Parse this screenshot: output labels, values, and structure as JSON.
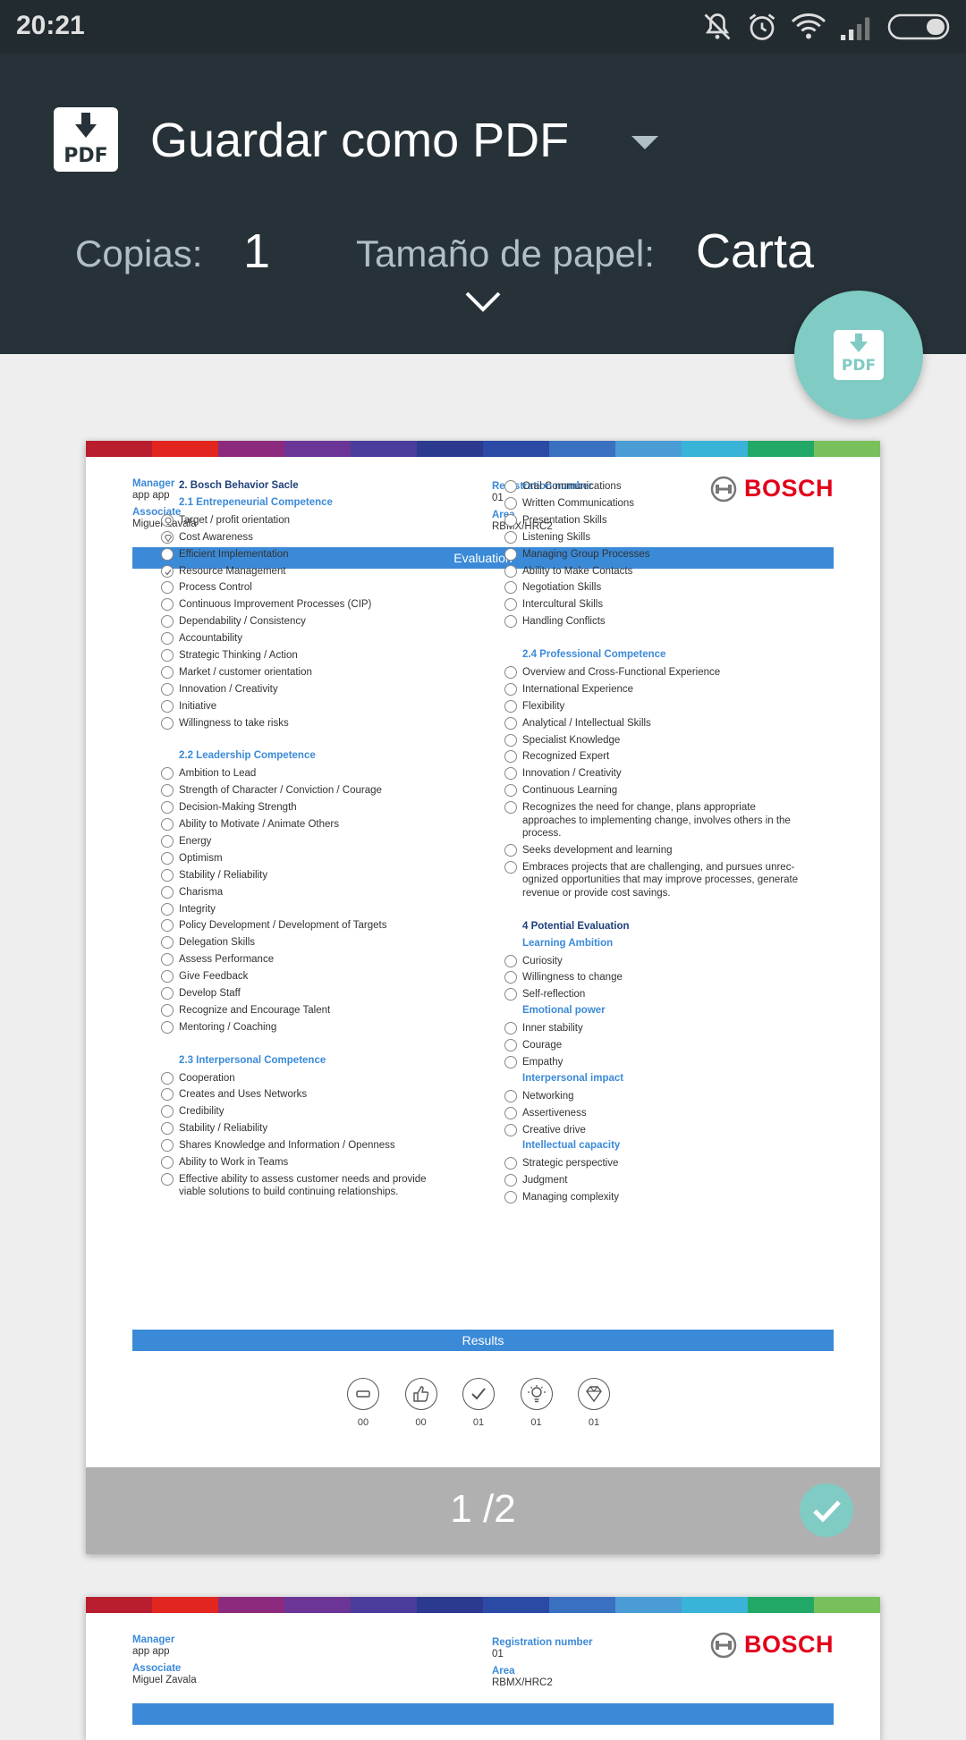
{
  "status_bar": {
    "time": "20:21"
  },
  "header": {
    "destination": "Guardar como PDF",
    "pdf_icon_label": "PDF",
    "copies_label": "Copias:",
    "copies_value": "1",
    "paper_label": "Tamaño de papel:",
    "paper_value": "Carta",
    "fab_label": "PDF"
  },
  "colors": {
    "header_bg": "#263238",
    "fab": "#80cbc4",
    "accent_blue": "#3b8ad8",
    "bosch_red": "#e2001a"
  },
  "document": {
    "manager_label": "Manager",
    "manager_value": "app app",
    "associate_label": "Associate",
    "associate_value": "Miguel Zavala",
    "reg_label": "Registration number",
    "reg_value": "01",
    "area_label": "Area",
    "area_value": "RBMX/HRC2",
    "brand": "BOSCH",
    "evaluation_title": "Evaluation",
    "results_title": "Results",
    "left_column": [
      {
        "type": "heading",
        "text": "2. Bosch Behavior Sacle",
        "dark": true
      },
      {
        "type": "heading",
        "text": "2.1 Entrepeneurial Competence"
      },
      {
        "type": "item",
        "text": "Target / profit orientation",
        "mark": "bulb"
      },
      {
        "type": "item",
        "text": "Cost Awareness",
        "mark": "gem"
      },
      {
        "type": "item",
        "text": "Efficient Implementation"
      },
      {
        "type": "item",
        "text": "Resource Management",
        "mark": "check"
      },
      {
        "type": "item",
        "text": "Process Control"
      },
      {
        "type": "item",
        "text": "Continuous Improvement Processes (CIP)"
      },
      {
        "type": "item",
        "text": "Dependability / Consistency"
      },
      {
        "type": "item",
        "text": "Accountability"
      },
      {
        "type": "item",
        "text": "Strategic Thinking / Action"
      },
      {
        "type": "item",
        "text": "Market / customer orientation"
      },
      {
        "type": "item",
        "text": "Innovation / Creativity"
      },
      {
        "type": "item",
        "text": "Initiative"
      },
      {
        "type": "item",
        "text": "Willingness to take risks"
      },
      {
        "type": "gap"
      },
      {
        "type": "heading",
        "text": "2.2 Leadership Competence"
      },
      {
        "type": "item",
        "text": "Ambition to Lead"
      },
      {
        "type": "item",
        "text": "Strength of Character / Conviction / Courage"
      },
      {
        "type": "item",
        "text": "Decision-Making Strength"
      },
      {
        "type": "item",
        "text": "Ability to Motivate / Animate Others"
      },
      {
        "type": "item",
        "text": "Energy"
      },
      {
        "type": "item",
        "text": "Optimism"
      },
      {
        "type": "item",
        "text": "Stability / Reliability"
      },
      {
        "type": "item",
        "text": "Charisma"
      },
      {
        "type": "item",
        "text": "Integrity"
      },
      {
        "type": "item",
        "text": "Policy Development / Development of Targets"
      },
      {
        "type": "item",
        "text": "Delegation Skills"
      },
      {
        "type": "item",
        "text": "Assess Performance"
      },
      {
        "type": "item",
        "text": "Give Feedback"
      },
      {
        "type": "item",
        "text": "Develop Staff"
      },
      {
        "type": "item",
        "text": "Recognize and Encourage Talent"
      },
      {
        "type": "item",
        "text": "Mentoring / Coaching"
      },
      {
        "type": "gap"
      },
      {
        "type": "heading",
        "text": "2.3 Interpersonal Competence"
      },
      {
        "type": "item",
        "text": "Cooperation"
      },
      {
        "type": "item",
        "text": "Creates and Uses Networks"
      },
      {
        "type": "item",
        "text": "Credibility"
      },
      {
        "type": "item",
        "text": "Stability / Reliability"
      },
      {
        "type": "item",
        "text": "Shares Knowledge and Information / Openness"
      },
      {
        "type": "item",
        "text": "Ability to Work in Teams"
      },
      {
        "type": "item",
        "lines": [
          "Effective ability to assess customer needs and provide",
          "viable solutions to build continuing relationships."
        ]
      }
    ],
    "right_column": [
      {
        "type": "item",
        "text": "Oral Communications"
      },
      {
        "type": "item",
        "text": "Written Communications"
      },
      {
        "type": "item",
        "text": "Presentation Skills"
      },
      {
        "type": "item",
        "text": "Listening Skills"
      },
      {
        "type": "item",
        "text": "Managing Group Processes"
      },
      {
        "type": "item",
        "text": "Ability to Make Contacts"
      },
      {
        "type": "item",
        "text": "Negotiation Skills"
      },
      {
        "type": "item",
        "text": "Intercultural Skills"
      },
      {
        "type": "item",
        "text": "Handling Conflicts"
      },
      {
        "type": "gap"
      },
      {
        "type": "heading",
        "text": "2.4 Professional Competence"
      },
      {
        "type": "item",
        "text": "Overview and Cross-Functional Experience"
      },
      {
        "type": "item",
        "text": "International Experience"
      },
      {
        "type": "item",
        "text": "Flexibility"
      },
      {
        "type": "item",
        "text": "Analytical / Intellectual Skills"
      },
      {
        "type": "item",
        "text": "Specialist Knowledge"
      },
      {
        "type": "item",
        "text": "Recognized Expert"
      },
      {
        "type": "item",
        "text": "Innovation / Creativity"
      },
      {
        "type": "item",
        "text": "Continuous Learning"
      },
      {
        "type": "item",
        "lines": [
          "Recognizes the need for change, plans appropriate",
          "approaches to implementing change, involves others in the",
          "process."
        ]
      },
      {
        "type": "item",
        "text": "Seeks development and learning"
      },
      {
        "type": "item",
        "lines": [
          "Embraces projects that are challenging, and pursues unrec-",
          "ognized opportunities that may improve processes, generate",
          "revenue or provide cost savings."
        ]
      },
      {
        "type": "gap"
      },
      {
        "type": "heading",
        "text": "4 Potential Evaluation",
        "dark": true
      },
      {
        "type": "heading",
        "text": "Learning Ambition"
      },
      {
        "type": "item",
        "text": "Curiosity"
      },
      {
        "type": "item",
        "text": "Willingness to change"
      },
      {
        "type": "item",
        "text": "Self-reflection"
      },
      {
        "type": "heading",
        "text": "Emotional power"
      },
      {
        "type": "item",
        "text": "Inner stability"
      },
      {
        "type": "item",
        "text": "Courage"
      },
      {
        "type": "item",
        "text": "Empathy"
      },
      {
        "type": "heading",
        "text": "Interpersonal impact"
      },
      {
        "type": "item",
        "text": "Networking"
      },
      {
        "type": "item",
        "text": "Assertiveness"
      },
      {
        "type": "item",
        "text": "Creative drive"
      },
      {
        "type": "heading",
        "text": "Intellectual capacity"
      },
      {
        "type": "item",
        "text": "Strategic perspective"
      },
      {
        "type": "item",
        "text": "Judgment"
      },
      {
        "type": "item",
        "text": "Managing complexity"
      }
    ],
    "results": [
      {
        "icon": "minus-icon",
        "count": "00"
      },
      {
        "icon": "thumbs-up-icon",
        "count": "00"
      },
      {
        "icon": "check-icon",
        "count": "01"
      },
      {
        "icon": "lightbulb-icon",
        "count": "01"
      },
      {
        "icon": "diamond-icon",
        "count": "01"
      }
    ]
  },
  "preview": {
    "page_indicator": "1 /2"
  }
}
